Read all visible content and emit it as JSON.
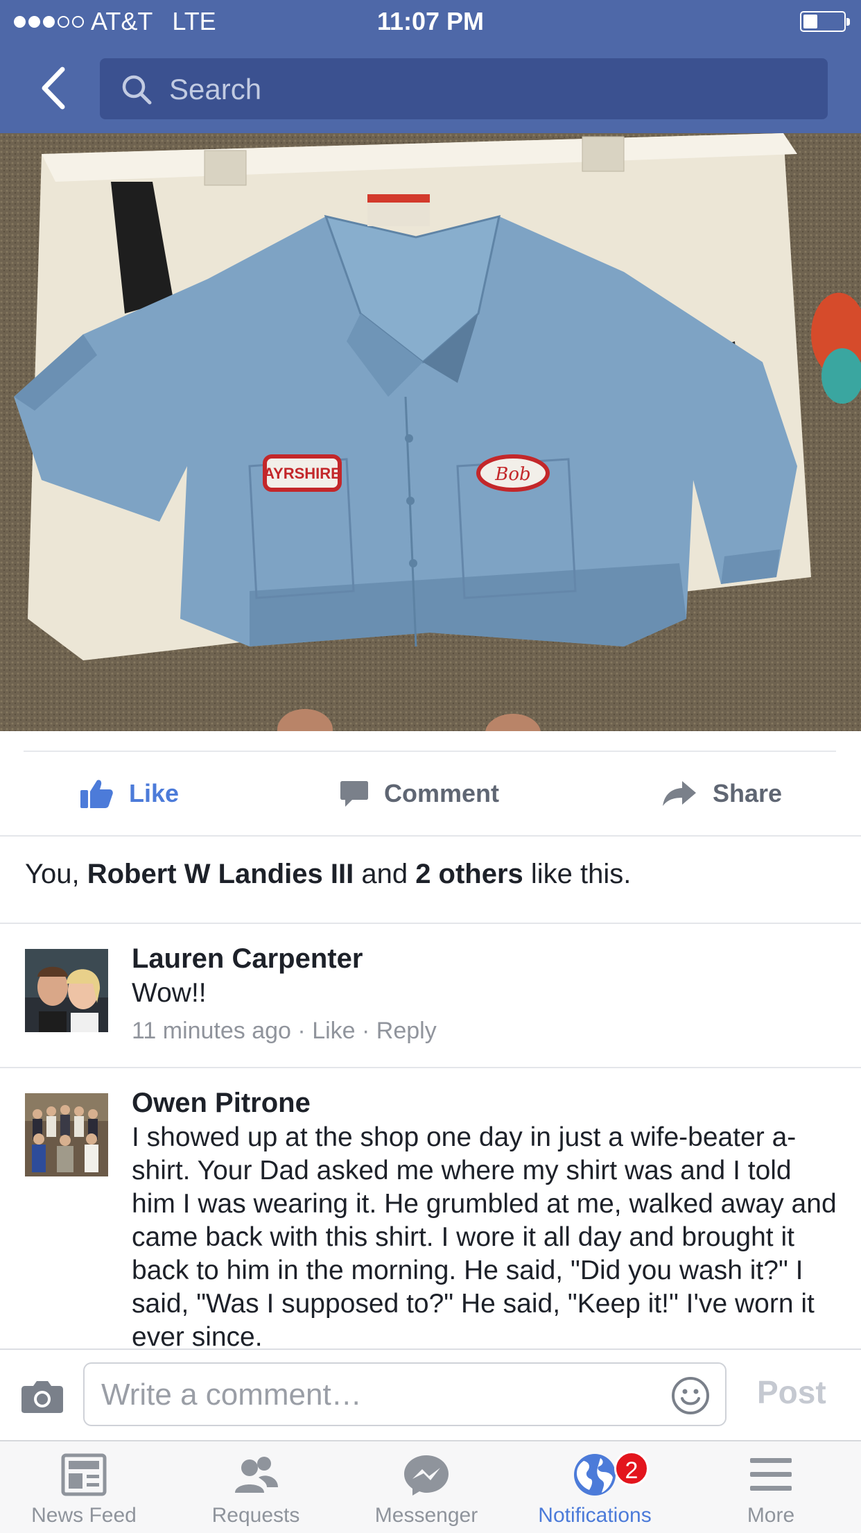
{
  "status": {
    "signal_dots_filled": 3,
    "signal_dots_total": 5,
    "carrier": "AT&T",
    "network": "LTE",
    "time": "11:07 PM",
    "battery_level": 0.35
  },
  "nav": {
    "back_icon": "chevron-left-icon",
    "search_placeholder": "Search"
  },
  "photo": {
    "patch_left": "AYRSHIRE",
    "patch_right": "Bob"
  },
  "actions": {
    "like": "Like",
    "comment": "Comment",
    "share": "Share"
  },
  "likes": {
    "prefix": "You, ",
    "name": "Robert W Landies III",
    "middle": " and ",
    "others": "2 others",
    "suffix": " like this."
  },
  "comments": [
    {
      "name": "Lauren Carpenter",
      "text": "Wow!!",
      "time": "11 minutes ago",
      "sep1": " · ",
      "like": "Like",
      "sep2": " · ",
      "reply": "Reply"
    },
    {
      "name": "Owen Pitrone",
      "text": "I showed up at the shop one day in just a wife-beater a-shirt.  Your Dad asked me where my shirt was and I told him I was wearing it.  He grumbled at me, walked away and came back with this shirt.  I wore it all day and brought it back to him in the morning.  He said, \"Did you wash it?\" I said, \"Was I supposed to?\" He said, \"Keep it!\" I've worn it ever since."
    }
  ],
  "composer": {
    "placeholder": "Write a comment…",
    "post": "Post"
  },
  "tabs": [
    {
      "label": "News Feed",
      "icon": "news-feed-icon"
    },
    {
      "label": "Requests",
      "icon": "friend-requests-icon"
    },
    {
      "label": "Messenger",
      "icon": "messenger-icon"
    },
    {
      "label": "Notifications",
      "icon": "globe-icon",
      "badge": "2",
      "active": true
    },
    {
      "label": "More",
      "icon": "menu-icon"
    }
  ],
  "colors": {
    "brand": "#4e68a8",
    "accent": "#4c7bd9",
    "badge": "#e3151d"
  }
}
